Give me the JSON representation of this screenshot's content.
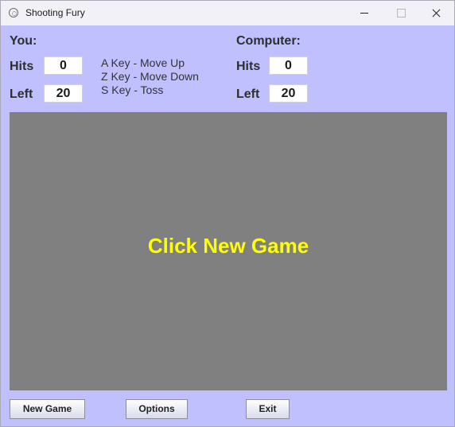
{
  "window": {
    "title": "Shooting Fury",
    "background": "#c0c0ff"
  },
  "player": {
    "heading": "You:",
    "hits_label": "Hits",
    "hits_value": "0",
    "left_label": "Left",
    "left_value": "20"
  },
  "instructions": {
    "lines": [
      "A Key - Move Up",
      "Z Key - Move Down",
      "S Key - Toss"
    ]
  },
  "computer": {
    "heading": "Computer:",
    "hits_label": "Hits",
    "hits_value": "0",
    "left_label": "Left",
    "left_value": "20"
  },
  "game": {
    "message": "Click New Game",
    "background": "#808080",
    "message_color": "#ffff00"
  },
  "buttons": {
    "new_game": "New Game",
    "options": "Options",
    "exit": "Exit"
  }
}
